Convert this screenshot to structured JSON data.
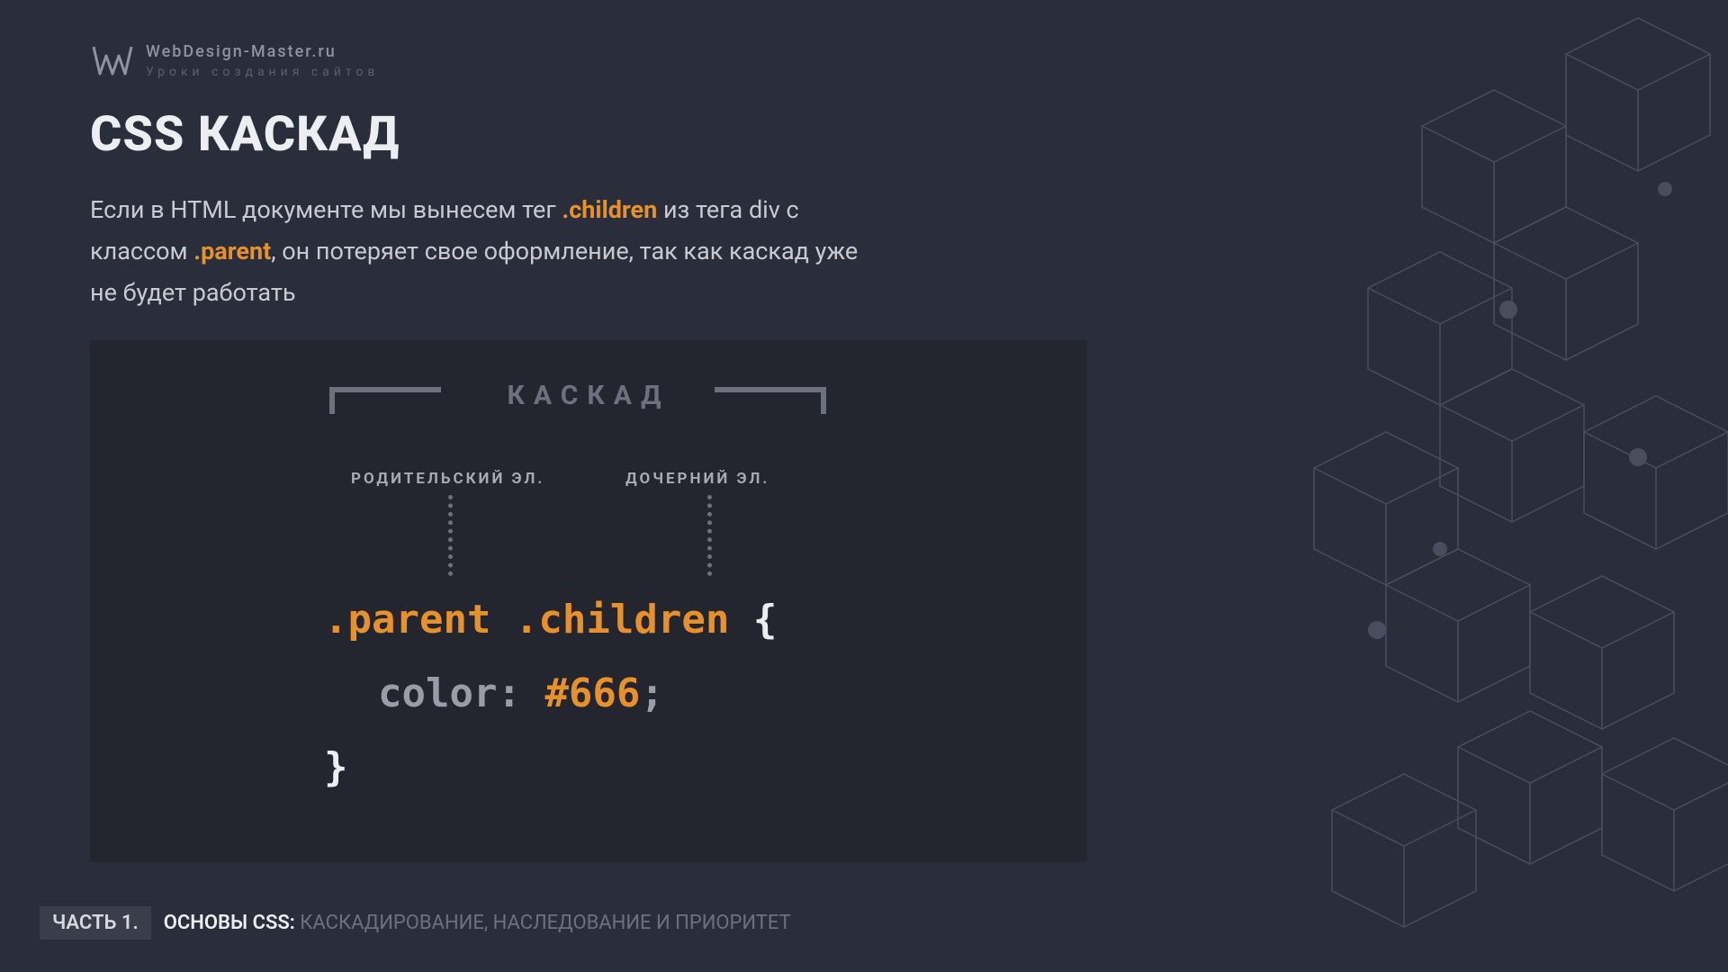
{
  "header": {
    "site": "WebDesign-Master.ru",
    "tagline": "Уроки создания сайтов"
  },
  "title": "CSS КАСКАД",
  "paragraph": {
    "p1": "Если в HTML документе мы вынесем тег ",
    "hl1": ".children",
    "p2": " из тега div с классом ",
    "hl2": ".parent",
    "p3": ", он потеряет свое оформление, так как каскад уже не будет работать"
  },
  "codebox": {
    "cascade_label": "КАСКАД",
    "label_parent": "РОДИТЕЛЬСКИЙ ЭЛ.",
    "label_child": "ДОЧЕРНИЙ ЭЛ.",
    "code": {
      "selector": ".parent .children",
      "brace_open": " {",
      "property": "color:",
      "value": " #666",
      "semicolon": ";",
      "brace_close": "}"
    }
  },
  "footer": {
    "badge": "ЧАСТЬ 1.",
    "strong": "ОСНОВЫ CSS: ",
    "dim": "КАСКАДИРОВАНИЕ, НАСЛЕДОВАНИЕ И ПРИОРИТЕТ"
  }
}
